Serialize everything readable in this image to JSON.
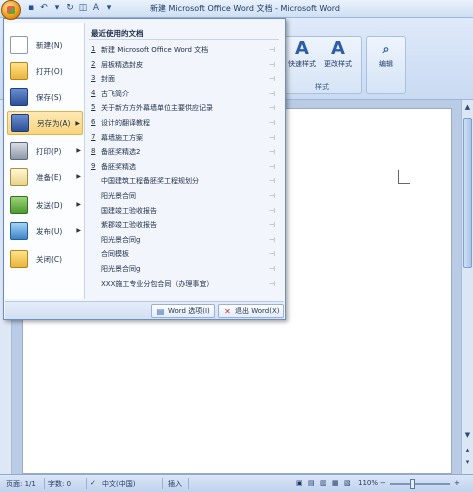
{
  "window": {
    "title": "新建 Microsoft Office Word 文档 - Microsoft Word"
  },
  "ribbon": {
    "styles_button_1": "快速样式",
    "styles_button_2": "更改样式",
    "edit_button": "编辑",
    "styles_group_label": "样式"
  },
  "office_menu": {
    "left_items": [
      {
        "label": "新建(N)",
        "icon": "new-document-icon",
        "has_submenu": false
      },
      {
        "label": "打开(O)",
        "icon": "open-folder-icon",
        "has_submenu": false
      },
      {
        "label": "保存(S)",
        "icon": "save-disk-icon",
        "has_submenu": false
      },
      {
        "label": "另存为(A)",
        "icon": "save-as-icon",
        "has_submenu": true
      },
      {
        "label": "打印(P)",
        "icon": "printer-icon",
        "has_submenu": true
      },
      {
        "label": "准备(E)",
        "icon": "prepare-icon",
        "has_submenu": true
      },
      {
        "label": "发送(D)",
        "icon": "send-icon",
        "has_submenu": true
      },
      {
        "label": "发布(U)",
        "icon": "publish-icon",
        "has_submenu": true
      },
      {
        "label": "关闭(C)",
        "icon": "close-folder-icon",
        "has_submenu": false
      }
    ],
    "recent_title": "最近使用的文档",
    "recent_documents": [
      {
        "num": "1",
        "name": "新建 Microsoft Office Word 文档"
      },
      {
        "num": "2",
        "name": "层板精选封皮"
      },
      {
        "num": "3",
        "name": "封面"
      },
      {
        "num": "4",
        "name": "古飞简介"
      },
      {
        "num": "5",
        "name": "关于新方方外幕墙单位主要供应记录"
      },
      {
        "num": "6",
        "name": "设计的翻译教程"
      },
      {
        "num": "7",
        "name": "幕墙施工方案"
      },
      {
        "num": "8",
        "name": "备胚奖精选2"
      },
      {
        "num": "9",
        "name": "备胚奖精选"
      },
      {
        "num": "",
        "name": "中国建筑工程备胚奖工程规划分"
      },
      {
        "num": "",
        "name": "阳光景合同"
      },
      {
        "num": "",
        "name": "国建竣工验收报告"
      },
      {
        "num": "",
        "name": "紫郡竣工验收报告"
      },
      {
        "num": "",
        "name": "阳光景合同g"
      },
      {
        "num": "",
        "name": "合同模板"
      },
      {
        "num": "",
        "name": "阳光景合同g"
      },
      {
        "num": "",
        "name": "XXX施工专业分包合同（办理事宜）"
      }
    ],
    "footer": {
      "options_label": "Word 选项(I)",
      "exit_label": "退出 Word(X)"
    }
  },
  "statusbar": {
    "page": "页面: 1/1",
    "words": "字数: 0",
    "language": "中文(中国)",
    "insert_mode": "插入",
    "zoom": "110%"
  },
  "colors": {
    "accent": "#2d5ca8",
    "menu_border": "#6d8ebf",
    "highlight": "#f9d57c"
  }
}
